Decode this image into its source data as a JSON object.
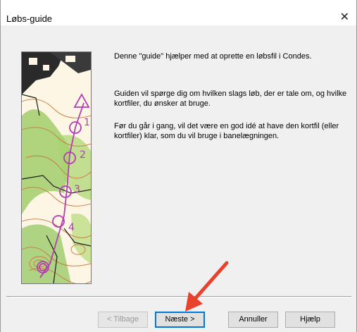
{
  "window": {
    "title": "Løbs-guide",
    "close_glyph": "✕"
  },
  "paragraphs": [
    "Denne \"guide\" hjælper med at oprette en løbsfil i Condes.",
    "Guiden vil spørge dig om hvilken slags løb, der er tale om, og hvilke kortfiler, du ønsker at bruge.",
    "Før du går i gang, vil det være en god idé at have den kortfil (eller kortfiler) klar, som du vil bruge i banelægningen."
  ],
  "map_labels": [
    "1",
    "2",
    "3",
    "4"
  ],
  "buttons": {
    "back": "< Tilbage",
    "next": "Næste >",
    "cancel": "Annuller",
    "help": "Hjælp"
  },
  "annotation": {
    "color": "#e8412c",
    "icon": "pointer-arrow"
  },
  "colors": {
    "course": "#b43cb4",
    "vegetation": "#78b43c",
    "contour": "#c8783c"
  }
}
